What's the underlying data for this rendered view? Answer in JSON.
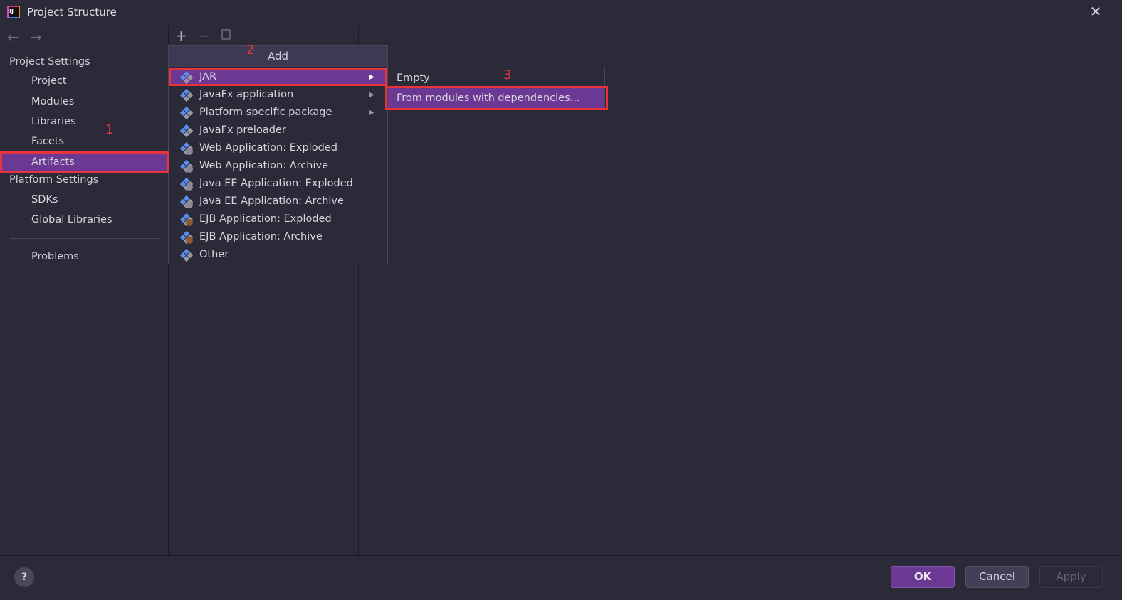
{
  "window": {
    "title": "Project Structure",
    "close_icon": "close-icon"
  },
  "sidebar": {
    "project_settings": "Project Settings",
    "items": [
      {
        "label": "Project"
      },
      {
        "label": "Modules"
      },
      {
        "label": "Libraries"
      },
      {
        "label": "Facets"
      },
      {
        "label": "Artifacts",
        "selected": true
      }
    ],
    "platform_settings": "Platform Settings",
    "platform_items": [
      {
        "label": "SDKs"
      },
      {
        "label": "Global Libraries"
      }
    ],
    "problems": "Problems"
  },
  "toolbar": {
    "add": "+",
    "remove": "−"
  },
  "popup": {
    "header": "Add",
    "items": [
      {
        "label": "JAR",
        "submenu": true,
        "selected": true
      },
      {
        "label": "JavaFx application",
        "submenu": true
      },
      {
        "label": "Platform specific package",
        "submenu": true
      },
      {
        "label": "JavaFx preloader"
      },
      {
        "label": "Web Application: Exploded"
      },
      {
        "label": "Web Application: Archive"
      },
      {
        "label": "Java EE Application: Exploded"
      },
      {
        "label": "Java EE Application: Archive"
      },
      {
        "label": "EJB Application: Exploded"
      },
      {
        "label": "EJB Application: Archive"
      },
      {
        "label": "Other"
      }
    ]
  },
  "submenu": {
    "items": [
      {
        "label": "Empty"
      },
      {
        "label": "From modules with dependencies...",
        "selected": true
      }
    ]
  },
  "annotations": {
    "step1": "1",
    "step2": "2",
    "step3": "3"
  },
  "footer": {
    "help": "?",
    "ok": "OK",
    "cancel": "Cancel",
    "apply": "Apply"
  },
  "colors": {
    "background": "#2b2a38",
    "selection": "#6b3893",
    "annotation": "#e8323c"
  }
}
